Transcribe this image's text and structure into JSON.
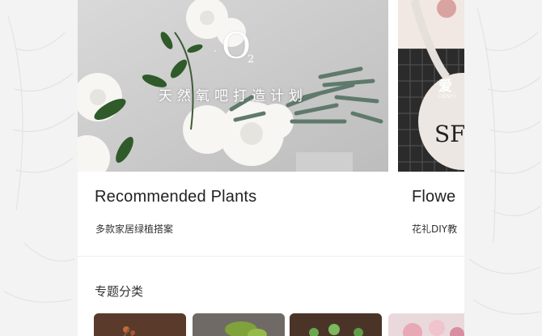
{
  "cards": [
    {
      "title": "Recommended Plants",
      "subtitle": "多款家居绿植搭案",
      "logo_text": "O",
      "logo_sub": "2",
      "image_caption": "天然氧吧打造计划"
    },
    {
      "title": "Flowe",
      "subtitle": "花礼DIY教",
      "image_caption": "爱",
      "image_caption_small": "CONFI"
    }
  ],
  "section": {
    "title": "专题分类"
  },
  "thumbnails": [
    {
      "icon": "dried-flower-photo"
    },
    {
      "icon": "green-plant-photo"
    },
    {
      "icon": "succulent-photo"
    },
    {
      "icon": "pink-rose-photo"
    }
  ],
  "colors": {
    "background": "#f3f3f3",
    "card": "#ffffff",
    "title_text": "#222222",
    "leaf_green": "#2f5a2a"
  }
}
